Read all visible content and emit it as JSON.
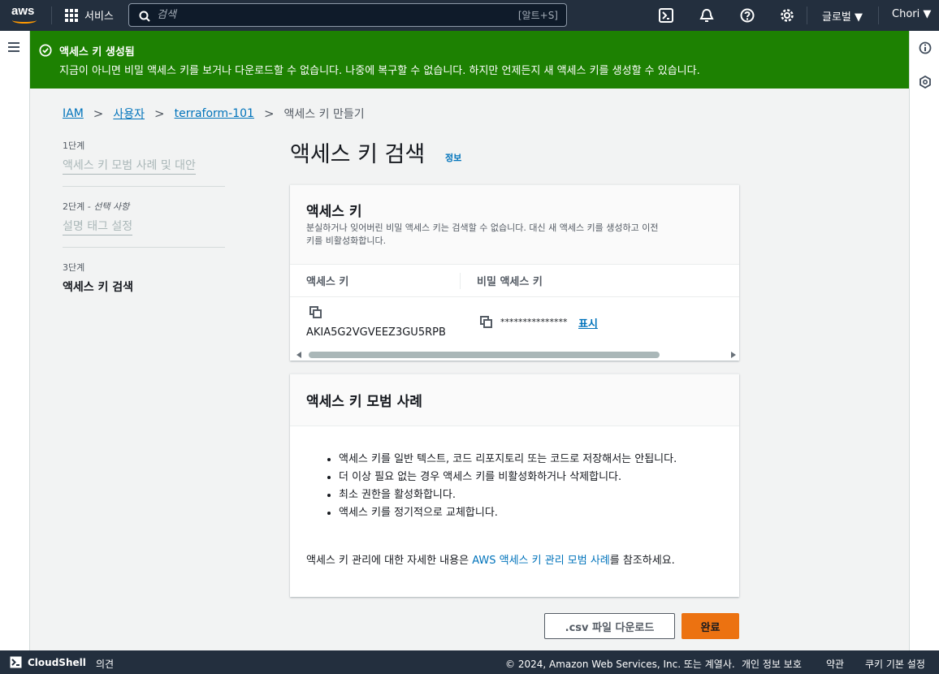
{
  "topnav": {
    "logo_text": "aws",
    "services_label": "서비스",
    "search_placeholder": "검색",
    "search_shortcut": "[알트+S]",
    "region_label": "글로벌 ▼",
    "user_label": "Chori ▼"
  },
  "flash": {
    "title": "액세스 키 생성됨",
    "message": "지금이 아니면 비밀 액세스 키를 보거나 다운로드할 수 없습니다. 나중에 복구할 수 없습니다. 하지만 언제든지 새 액세스 키를 생성할 수 있습니다."
  },
  "breadcrumb": {
    "items": [
      "IAM",
      "사용자",
      "terraform-101"
    ],
    "current": "액세스 키 만들기",
    "separator": ">"
  },
  "steps": [
    {
      "num": "1단계",
      "name": "액세스 키 모범 사례 및 대안"
    },
    {
      "num": "2단계",
      "optional": "- 선택 사항",
      "name": "설명 태그 설정"
    },
    {
      "num": "3단계",
      "name": "액세스 키 검색"
    }
  ],
  "page": {
    "title": "액세스 키 검색",
    "info_link": "정보"
  },
  "access_key_panel": {
    "title": "액세스 키",
    "description_line1": "분실하거나 잊어버린 비밀 액세스 키는 검색할 수 없습니다. 대신 새 액세스 키를 생성하고 이전",
    "description_line2": "키를 비활성화합니다.",
    "col_access_key": "액세스 키",
    "col_secret_key": "비밀 액세스 키",
    "access_key_value": "AKIA5G2VGVEEZ3GU5RPB",
    "secret_key_masked": "***************",
    "show_link": "표시"
  },
  "best_practice_panel": {
    "title": "액세스 키 모범 사례",
    "bullets": [
      "액세스 키를 일반 텍스트, 코드 리포지토리 또는 코드로 저장해서는 안됩니다.",
      "더 이상 필요 없는 경우 액세스 키를 비활성화하거나 삭제합니다.",
      "최소 권한을 활성화합니다.",
      "액세스 키를 정기적으로 교체합니다."
    ],
    "ref_prefix": "액세스 키 관리에 대한 자세한 내용은 ",
    "ref_link": "AWS 액세스 키 관리 모범 사례",
    "ref_suffix": "를 참조하세요."
  },
  "buttons": {
    "download_csv": ".csv 파일 다운로드",
    "done": "완료"
  },
  "footer": {
    "cloudshell": "CloudShell",
    "feedback": "의견",
    "copyright": "© 2024, Amazon Web Services, Inc. 또는 계열사.",
    "privacy": "개인 정보 보호",
    "terms": "약관",
    "cookies": "쿠키 기본 설정"
  },
  "colors": {
    "nav_bg": "#232f3e",
    "flash_success": "#1d8102",
    "link": "#0073bb",
    "primary_button": "#ec7211"
  }
}
